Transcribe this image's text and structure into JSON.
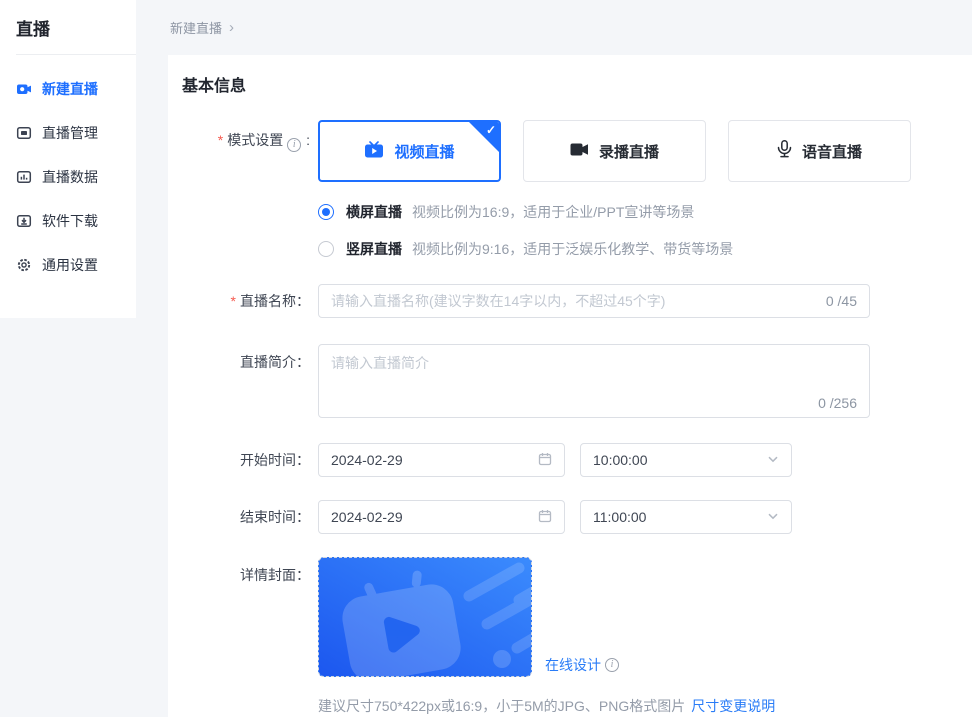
{
  "sidebar": {
    "title": "直播",
    "items": [
      {
        "label": "新建直播",
        "icon": "camera-create-icon",
        "active": true
      },
      {
        "label": "直播管理",
        "icon": "monitor-icon",
        "active": false
      },
      {
        "label": "直播数据",
        "icon": "bar-chart-icon",
        "active": false
      },
      {
        "label": "软件下载",
        "icon": "download-icon",
        "active": false
      },
      {
        "label": "通用设置",
        "icon": "gear-icon",
        "active": false
      }
    ]
  },
  "breadcrumb": {
    "current": "新建直播",
    "separator": "›"
  },
  "page": {
    "section_title": "基本信息"
  },
  "icons": {
    "check": "✓",
    "info": "i"
  },
  "form": {
    "required_mark": "*",
    "mode": {
      "label": "模式设置",
      "colon": " :",
      "options": [
        {
          "label": "视频直播",
          "icon": "tv-play-icon",
          "selected": true
        },
        {
          "label": "录播直播",
          "icon": "video-camera-icon",
          "selected": false
        },
        {
          "label": "语音直播",
          "icon": "microphone-icon",
          "selected": false
        }
      ],
      "orientations": [
        {
          "label": "横屏直播",
          "desc": "视频比例为16:9，适用于企业/PPT宣讲等场景",
          "selected": true
        },
        {
          "label": "竖屏直播",
          "desc": "视频比例为9:16，适用于泛娱乐化教学、带货等场景",
          "selected": false
        }
      ]
    },
    "name": {
      "label": "直播名称：",
      "placeholder": "请输入直播名称(建议字数在14字以内，不超过45个字)",
      "value": "",
      "counter": "0 /45"
    },
    "intro": {
      "label": "直播简介：",
      "placeholder": "请输入直播简介",
      "value": "",
      "counter": "0 /256"
    },
    "start": {
      "label": "开始时间：",
      "date": "2024-02-29",
      "time": "10:00:00"
    },
    "end": {
      "label": "结束时间：",
      "date": "2024-02-29",
      "time": "11:00:00"
    },
    "cover": {
      "label": "详情封面：",
      "design_link": "在线设计",
      "hint": "建议尺寸750*422px或16:9，小于5M的JPG、PNG格式图片",
      "hint_link": "尺寸变更说明"
    }
  },
  "colors": {
    "accent": "#1e6fff",
    "required": "#f5594e",
    "link": "#2a7cf7",
    "cover_gradient_light": "#3b8bfd",
    "cover_gradient_dark": "#1c57ef"
  }
}
